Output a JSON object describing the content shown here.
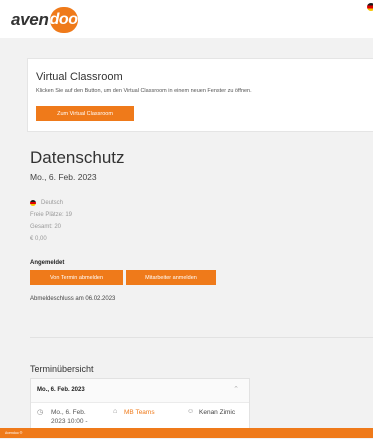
{
  "brand": {
    "logo_left": "aven",
    "logo_right": "doo",
    "accent": "#ef7a1a"
  },
  "virtual_classroom": {
    "title": "Virtual Classroom",
    "text": "Klicken Sie auf den Button, um den Virtual Classroom in einem neuen Fenster zu öffnen.",
    "button": "Zum Virtual Classroom"
  },
  "course": {
    "title": "Datenschutz",
    "date": "Mo., 6. Feb. 2023",
    "language": "Deutsch",
    "free_places": "Freie Plätze: 19",
    "total": "Gesamt: 20",
    "price": "€ 0,00"
  },
  "registration": {
    "status": "Angemeldet",
    "unregister_button": "Von Termin abmelden",
    "register_employee_button": "Mitarbeiter anmelden",
    "deadline": "Abmeldeschluss am 06.02.2023"
  },
  "overview": {
    "title": "Terminübersicht",
    "date_header": "Mo., 6. Feb. 2023",
    "time_line1": "Mo., 6. Feb.",
    "time_line2": "2023 10:00 -",
    "location": "MB Teams",
    "trainer": "Kenan Zimic"
  },
  "footer": {
    "text": "Avendoo ®"
  }
}
